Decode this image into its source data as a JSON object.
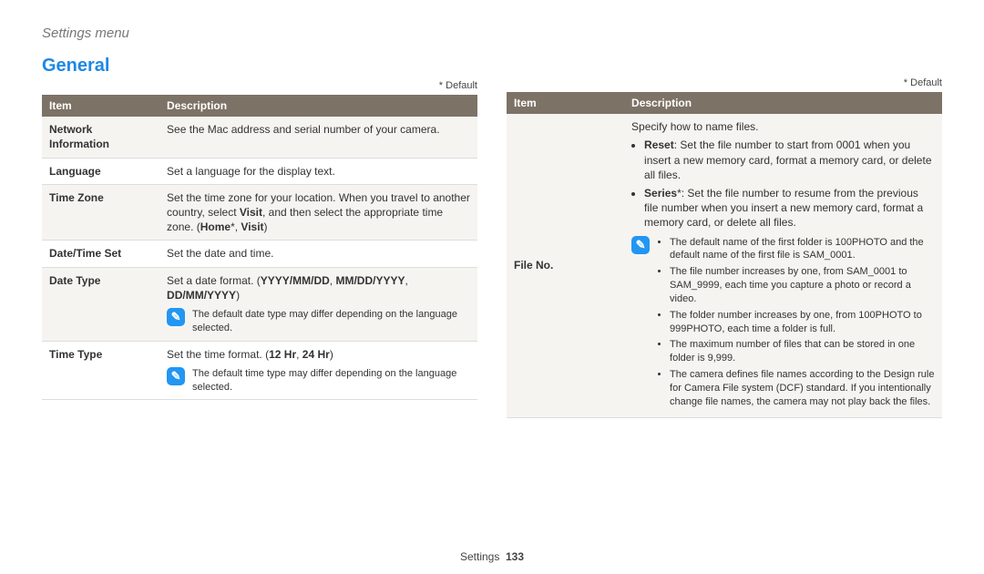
{
  "header": {
    "breadcrumb": "Settings menu"
  },
  "section_title": "General",
  "default_label": "* Default",
  "table_headers": {
    "item": "Item",
    "description": "Description"
  },
  "left_table": {
    "rows": [
      {
        "item": "Network Information",
        "desc": "See the Mac address and serial number of your camera."
      },
      {
        "item": "Language",
        "desc": "Set a language for the display text."
      },
      {
        "item": "Time Zone",
        "desc_segments": {
          "a": "Set the time zone for your location. When you travel to another country, select ",
          "b_bold": "Visit",
          "c": ", and then select the appropriate time zone. (",
          "d_bold": "Home",
          "e": "*, ",
          "f_bold": "Visit",
          "g": ")"
        }
      },
      {
        "item": "Date/Time Set",
        "desc": "Set the date and time."
      },
      {
        "item": "Date Type",
        "desc_segments": {
          "a": "Set a date format. (",
          "b_bold": "YYYY/MM/DD",
          "c": ", ",
          "d_bold": "MM/DD/YYYY",
          "e": ", ",
          "f_bold": "DD/MM/YYYY",
          "g": ")"
        },
        "note": "The default date type may differ depending on the language selected."
      },
      {
        "item": "Time Type",
        "desc_segments": {
          "a": "Set the time format. (",
          "b_bold": "12 Hr",
          "c": ", ",
          "d_bold": "24 Hr",
          "e": ")"
        },
        "note": "The default time type may differ depending on the language selected."
      }
    ]
  },
  "right_table": {
    "file_no": {
      "item": "File No.",
      "intro": "Specify how to name files.",
      "option_reset": {
        "label": "Reset",
        "text": ": Set the file number to start from 0001 when you insert a new memory card, format a memory card, or delete all files."
      },
      "option_series": {
        "label": "Series",
        "suffix": "*",
        "text": ": Set the file number to resume from the previous file number when you insert a new memory card, format a memory card, or delete all files."
      },
      "notes": [
        "The default name of the first folder is 100PHOTO and the default name of the first file is SAM_0001.",
        "The file number increases by one, from SAM_0001 to SAM_9999, each time you capture a photo or record a video.",
        "The folder number increases by one, from 100PHOTO to 999PHOTO, each time a folder is full.",
        "The maximum number of files that can be stored in one folder is 9,999.",
        "The camera defines file names according to the Design rule for Camera File system (DCF) standard. If you intentionally change file names, the camera may not play back the files."
      ]
    }
  },
  "footer": {
    "section": "Settings",
    "page": "133"
  }
}
